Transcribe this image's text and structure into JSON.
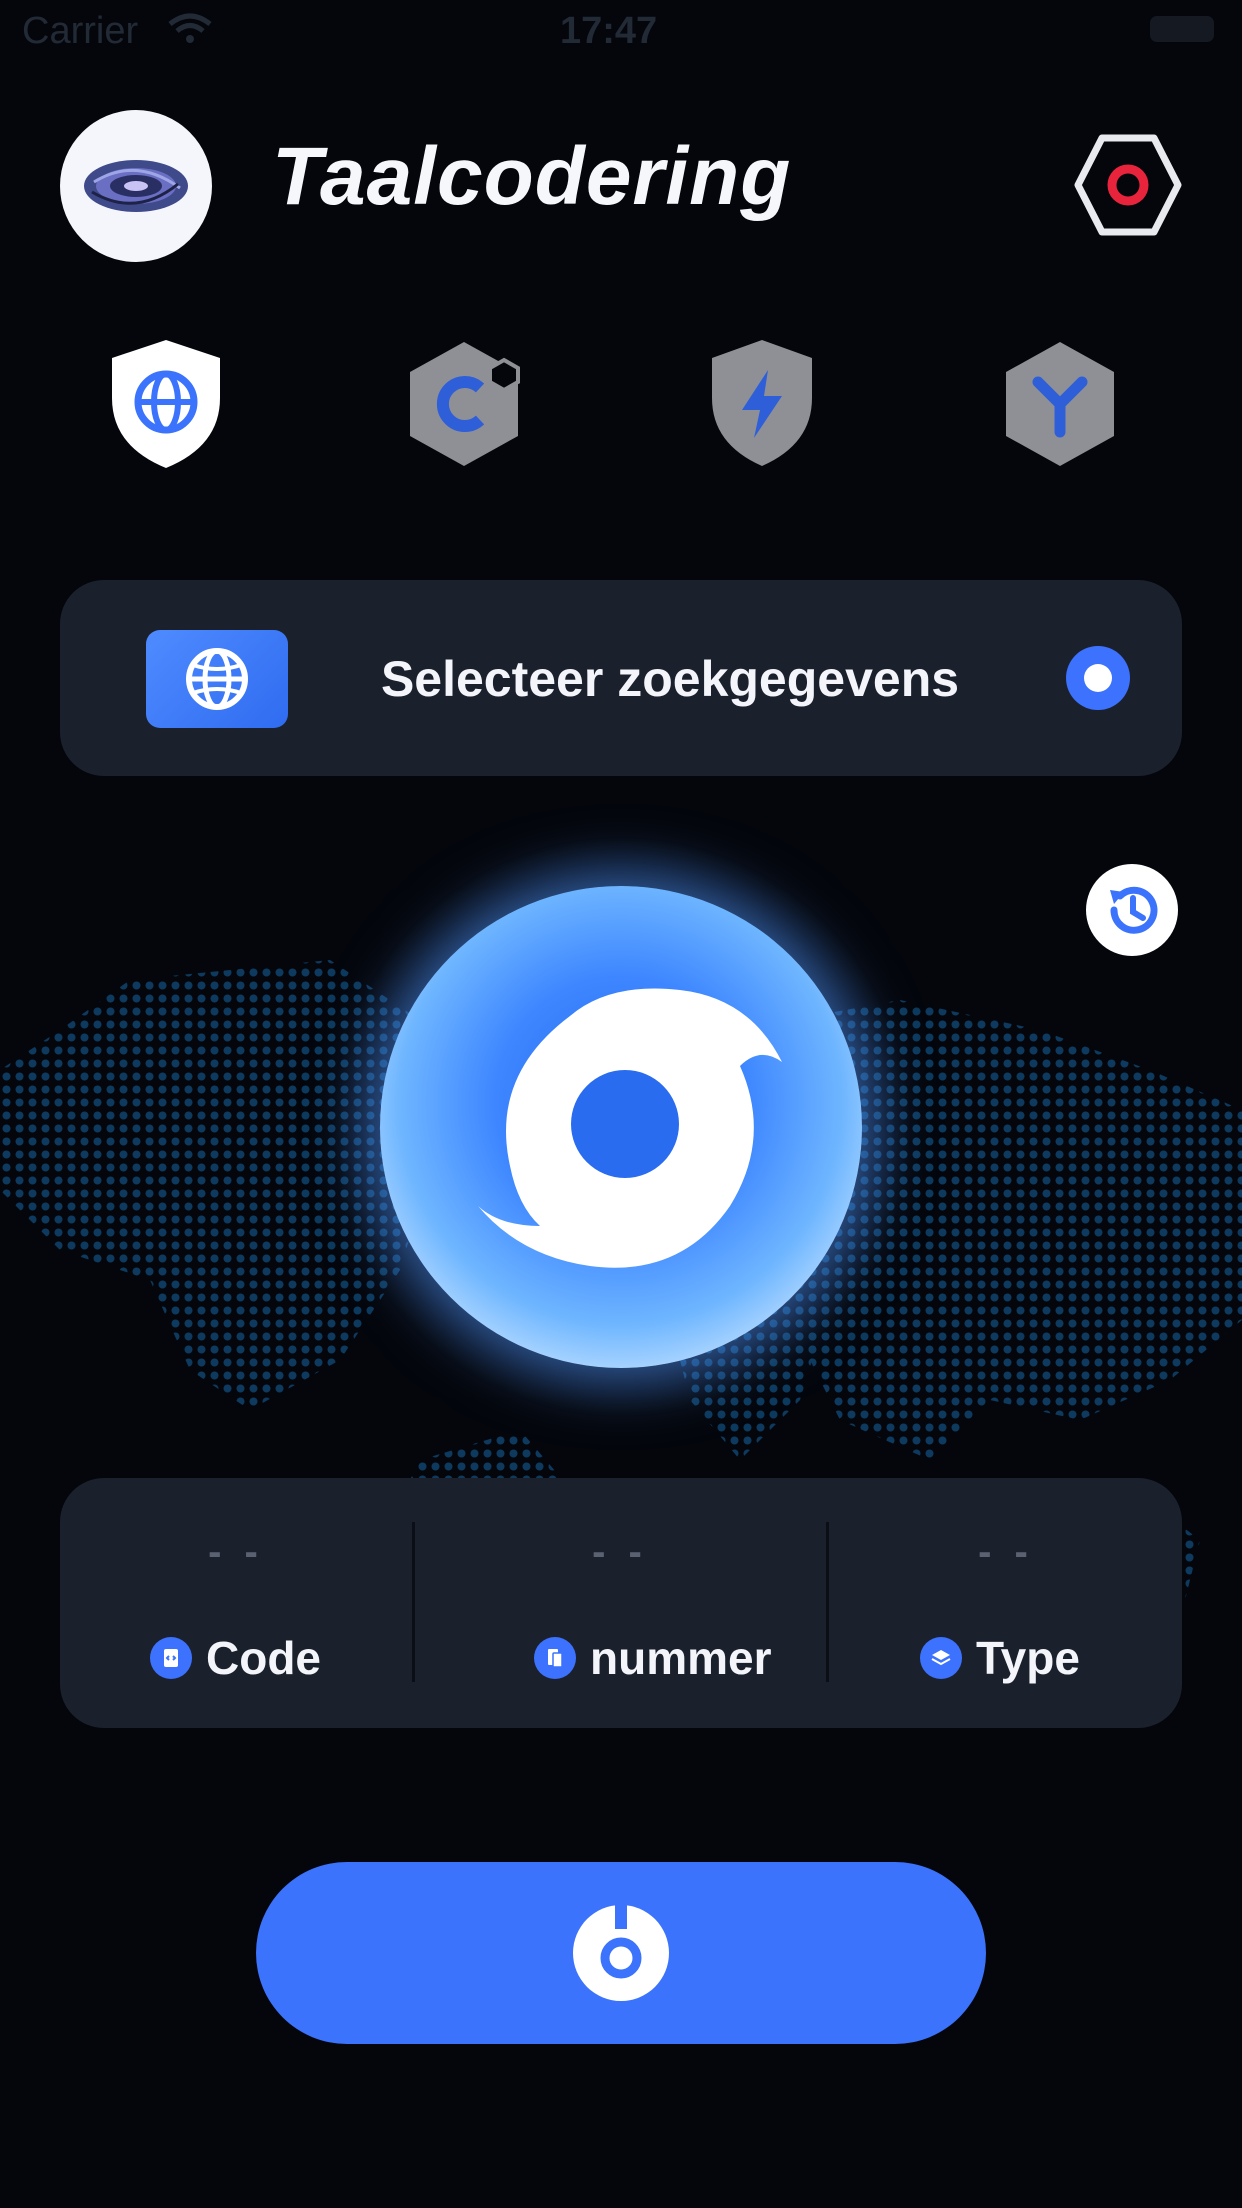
{
  "status_bar": {
    "carrier": "Carrier",
    "time": "17:47"
  },
  "header": {
    "title": "Taalcodering",
    "logo_icon": "galaxy-logo-icon",
    "settings_icon": "hexagon-settings-icon"
  },
  "mode_tabs": [
    {
      "icon": "globe-shield-icon",
      "active": true
    },
    {
      "icon": "hexagon-c-icon",
      "active": false
    },
    {
      "icon": "lightning-shield-icon",
      "active": false
    },
    {
      "icon": "y-hexagon-icon",
      "active": false
    }
  ],
  "selector": {
    "label": "Selecteer zoekgegevens",
    "icon": "globe-icon",
    "selected": true
  },
  "history_icon": "history-icon",
  "orb_icon": "swirl-icon",
  "stats": [
    {
      "value": "- -",
      "label": "Code",
      "icon": "code-file-icon"
    },
    {
      "value": "- -",
      "label": "nummer",
      "icon": "document-icon"
    },
    {
      "value": "- -",
      "label": "Type",
      "icon": "layers-icon"
    }
  ],
  "connect_icon": "power-icon",
  "colors": {
    "background": "#04060c",
    "card": "#1b212c",
    "accent": "#3b73fc",
    "inactive_icon": "#8e9096"
  }
}
